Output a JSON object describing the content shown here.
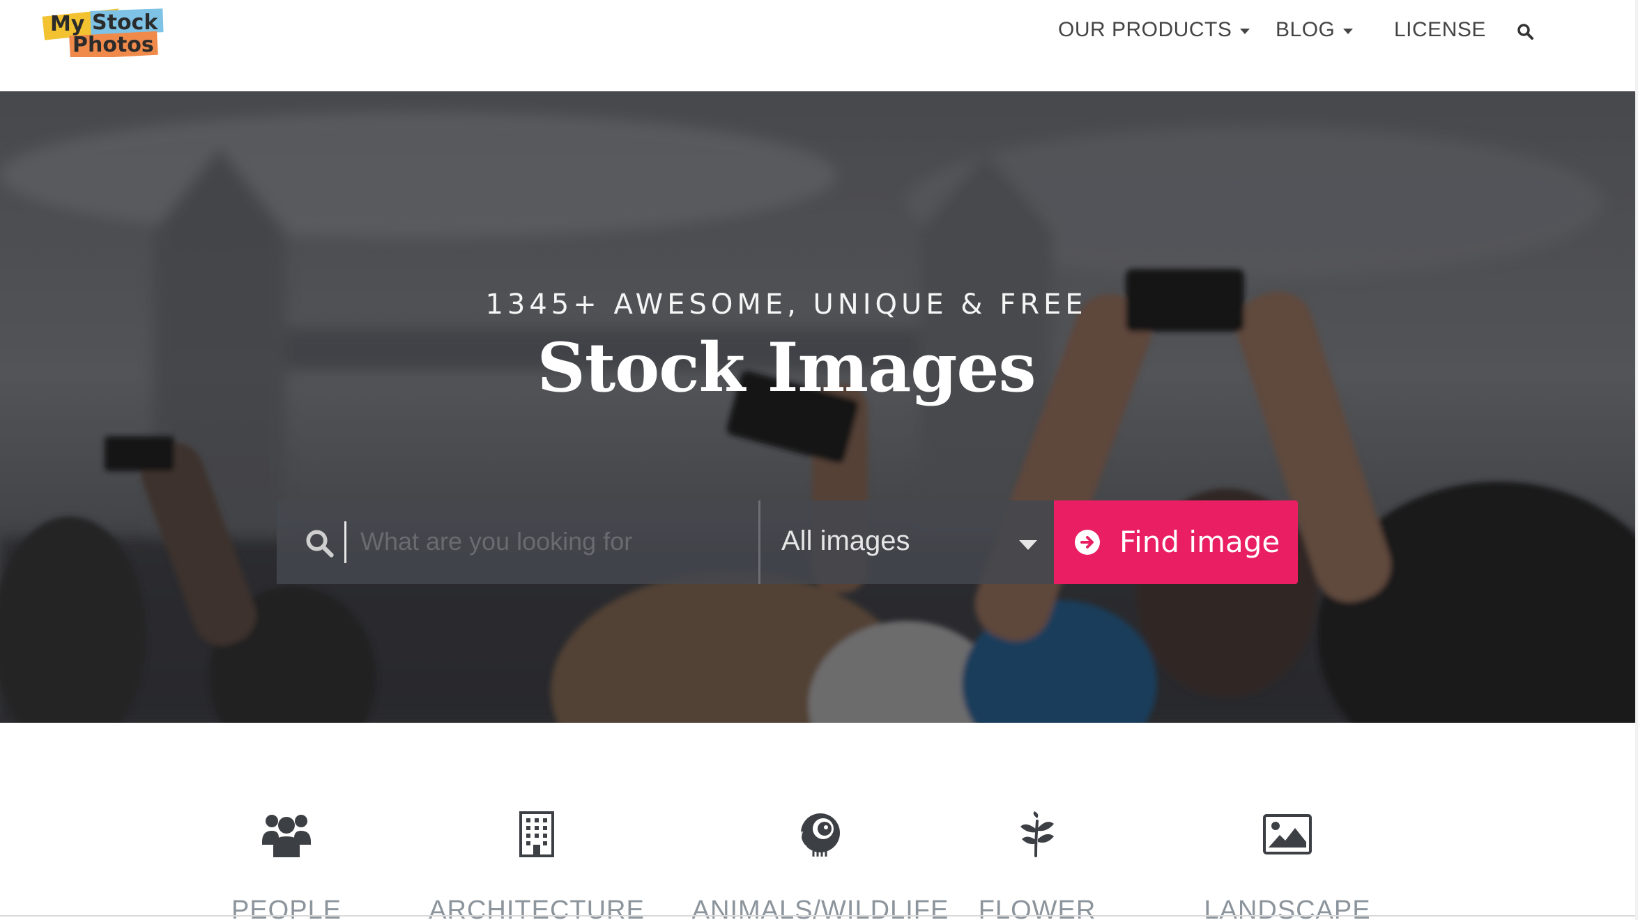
{
  "header": {
    "logo_text": [
      "My",
      "Stock",
      "Photos"
    ],
    "nav": [
      {
        "label": "OUR PRODUCTS",
        "dropdown": true
      },
      {
        "label": "BLOG",
        "dropdown": true
      },
      {
        "label": "LICENSE",
        "dropdown": false
      }
    ],
    "search_icon": "search-icon"
  },
  "hero": {
    "subtitle": "1345+ AWESOME, UNIQUE & FREE",
    "title": "Stock Images",
    "search": {
      "placeholder": "What are you looking for",
      "value": ""
    },
    "filter": {
      "selected": "All images"
    },
    "button_label": "Find image",
    "accent": "#e91e63"
  },
  "categories": [
    {
      "label": "PEOPLE",
      "icon": "users-icon"
    },
    {
      "label": "ARCHITECTURE",
      "icon": "building-icon"
    },
    {
      "label": "ANIMALS/WILDLIFE",
      "icon": "bird-icon"
    },
    {
      "label": "FLOWER",
      "icon": "leaf-icon"
    },
    {
      "label": "LANDSCAPE",
      "icon": "image-icon"
    }
  ]
}
